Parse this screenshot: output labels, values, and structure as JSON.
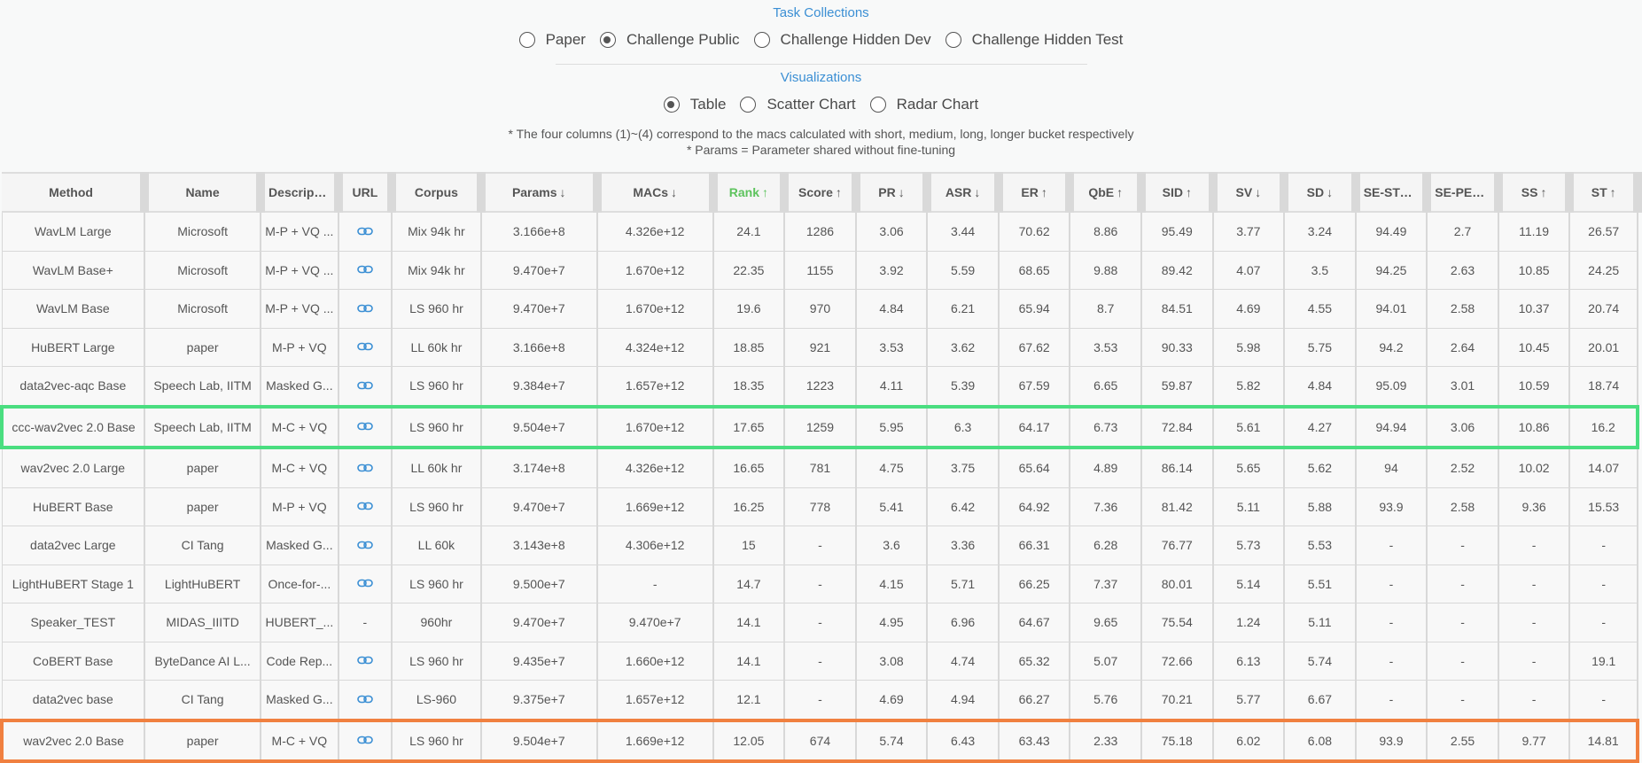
{
  "task_collections": {
    "title": "Task Collections",
    "options": [
      "Paper",
      "Challenge Public",
      "Challenge Hidden Dev",
      "Challenge Hidden Test"
    ],
    "selected_index": 1
  },
  "visualizations": {
    "title": "Visualizations",
    "options": [
      "Table",
      "Scatter Chart",
      "Radar Chart"
    ],
    "selected_index": 0
  },
  "notes": [
    "* The four columns (1)~(4) correspond to the macs calculated with short, medium, long, longer bucket respectively",
    "* Params = Parameter shared without fine-tuning"
  ],
  "columns": [
    {
      "label": "Method",
      "arrow": ""
    },
    {
      "label": "Name",
      "arrow": ""
    },
    {
      "label": "Description",
      "arrow": ""
    },
    {
      "label": "URL",
      "arrow": ""
    },
    {
      "label": "Corpus",
      "arrow": ""
    },
    {
      "label": "Params",
      "arrow": "↓"
    },
    {
      "label": "MACs",
      "arrow": "↓"
    },
    {
      "label": "Rank",
      "arrow": "↑"
    },
    {
      "label": "Score",
      "arrow": "↑"
    },
    {
      "label": "PR",
      "arrow": "↓"
    },
    {
      "label": "ASR",
      "arrow": "↓"
    },
    {
      "label": "ER",
      "arrow": "↑"
    },
    {
      "label": "QbE",
      "arrow": "↑"
    },
    {
      "label": "SID",
      "arrow": "↑"
    },
    {
      "label": "SV",
      "arrow": "↓"
    },
    {
      "label": "SD",
      "arrow": "↓"
    },
    {
      "label": "SE-STOI",
      "arrow": "↑"
    },
    {
      "label": "SE-PESQ",
      "arrow": "↑"
    },
    {
      "label": "SS",
      "arrow": "↑"
    },
    {
      "label": "ST",
      "arrow": "↑"
    }
  ],
  "rows": [
    {
      "cells": [
        "WavLM Large",
        "Microsoft",
        "M-P + VQ ...",
        "link",
        "Mix 94k hr",
        "3.166e+8",
        "4.326e+12",
        "24.1",
        "1286",
        "3.06",
        "3.44",
        "70.62",
        "8.86",
        "95.49",
        "3.77",
        "3.24",
        "94.49",
        "2.7",
        "11.19",
        "26.57"
      ]
    },
    {
      "cells": [
        "WavLM Base+",
        "Microsoft",
        "M-P + VQ ...",
        "link",
        "Mix 94k hr",
        "9.470e+7",
        "1.670e+12",
        "22.35",
        "1155",
        "3.92",
        "5.59",
        "68.65",
        "9.88",
        "89.42",
        "4.07",
        "3.5",
        "94.25",
        "2.63",
        "10.85",
        "24.25"
      ]
    },
    {
      "cells": [
        "WavLM Base",
        "Microsoft",
        "M-P + VQ ...",
        "link",
        "LS 960 hr",
        "9.470e+7",
        "1.670e+12",
        "19.6",
        "970",
        "4.84",
        "6.21",
        "65.94",
        "8.7",
        "84.51",
        "4.69",
        "4.55",
        "94.01",
        "2.58",
        "10.37",
        "20.74"
      ]
    },
    {
      "cells": [
        "HuBERT Large",
        "paper",
        "M-P + VQ",
        "link",
        "LL 60k hr",
        "3.166e+8",
        "4.324e+12",
        "18.85",
        "921",
        "3.53",
        "3.62",
        "67.62",
        "3.53",
        "90.33",
        "5.98",
        "5.75",
        "94.2",
        "2.64",
        "10.45",
        "20.01"
      ]
    },
    {
      "cells": [
        "data2vec-aqc Base",
        "Speech Lab, IITM",
        "Masked G...",
        "link",
        "LS 960 hr",
        "9.384e+7",
        "1.657e+12",
        "18.35",
        "1223",
        "4.11",
        "5.39",
        "67.59",
        "6.65",
        "59.87",
        "5.82",
        "4.84",
        "95.09",
        "3.01",
        "10.59",
        "18.74"
      ]
    },
    {
      "highlight": "green",
      "cells": [
        "ccc-wav2vec 2.0 Base",
        "Speech Lab, IITM",
        "M-C + VQ",
        "link",
        "LS 960 hr",
        "9.504e+7",
        "1.670e+12",
        "17.65",
        "1259",
        "5.95",
        "6.3",
        "64.17",
        "6.73",
        "72.84",
        "5.61",
        "4.27",
        "94.94",
        "3.06",
        "10.86",
        "16.2"
      ]
    },
    {
      "cells": [
        "wav2vec 2.0 Large",
        "paper",
        "M-C + VQ",
        "link",
        "LL 60k hr",
        "3.174e+8",
        "4.326e+12",
        "16.65",
        "781",
        "4.75",
        "3.75",
        "65.64",
        "4.89",
        "86.14",
        "5.65",
        "5.62",
        "94",
        "2.52",
        "10.02",
        "14.07"
      ]
    },
    {
      "cells": [
        "HuBERT Base",
        "paper",
        "M-P + VQ",
        "link",
        "LS 960 hr",
        "9.470e+7",
        "1.669e+12",
        "16.25",
        "778",
        "5.41",
        "6.42",
        "64.92",
        "7.36",
        "81.42",
        "5.11",
        "5.88",
        "93.9",
        "2.58",
        "9.36",
        "15.53"
      ]
    },
    {
      "cells": [
        "data2vec Large",
        "CI Tang",
        "Masked G...",
        "link",
        "LL 60k",
        "3.143e+8",
        "4.306e+12",
        "15",
        "-",
        "3.6",
        "3.36",
        "66.31",
        "6.28",
        "76.77",
        "5.73",
        "5.53",
        "-",
        "-",
        "-",
        "-"
      ]
    },
    {
      "cells": [
        "LightHuBERT Stage 1",
        "LightHuBERT",
        "Once-for-...",
        "link",
        "LS 960 hr",
        "9.500e+7",
        "-",
        "14.7",
        "-",
        "4.15",
        "5.71",
        "66.25",
        "7.37",
        "80.01",
        "5.14",
        "5.51",
        "-",
        "-",
        "-",
        "-"
      ]
    },
    {
      "cells": [
        "Speaker_TEST",
        "MIDAS_IIITD",
        "HUBERT_...",
        "-",
        "960hr",
        "9.470e+7",
        "9.470e+7",
        "14.1",
        "-",
        "4.95",
        "6.96",
        "64.67",
        "9.65",
        "75.54",
        "1.24",
        "5.11",
        "-",
        "-",
        "-",
        "-"
      ]
    },
    {
      "cells": [
        "CoBERT Base",
        "ByteDance AI L...",
        "Code Rep...",
        "link",
        "LS 960 hr",
        "9.435e+7",
        "1.660e+12",
        "14.1",
        "-",
        "3.08",
        "4.74",
        "65.32",
        "5.07",
        "72.66",
        "6.13",
        "5.74",
        "-",
        "-",
        "-",
        "19.1"
      ]
    },
    {
      "cells": [
        "data2vec base",
        "CI Tang",
        "Masked G...",
        "link",
        "LS-960",
        "9.375e+7",
        "1.657e+12",
        "12.1",
        "-",
        "4.69",
        "4.94",
        "66.27",
        "5.76",
        "70.21",
        "5.77",
        "6.67",
        "-",
        "-",
        "-",
        "-"
      ]
    },
    {
      "highlight": "orange",
      "cells": [
        "wav2vec 2.0 Base",
        "paper",
        "M-C + VQ",
        "link",
        "LS 960 hr",
        "9.504e+7",
        "1.669e+12",
        "12.05",
        "674",
        "5.74",
        "6.43",
        "63.43",
        "2.33",
        "75.18",
        "6.02",
        "6.08",
        "93.9",
        "2.55",
        "9.77",
        "14.81"
      ]
    }
  ],
  "colors": {
    "accent": "#3b8fd4",
    "rank_header": "#5dc35d",
    "green_highlight": "#4ade80",
    "orange_highlight": "#f08040",
    "link_icon": "#3b8fd4"
  },
  "icons": {
    "url_cell": "link-icon"
  }
}
